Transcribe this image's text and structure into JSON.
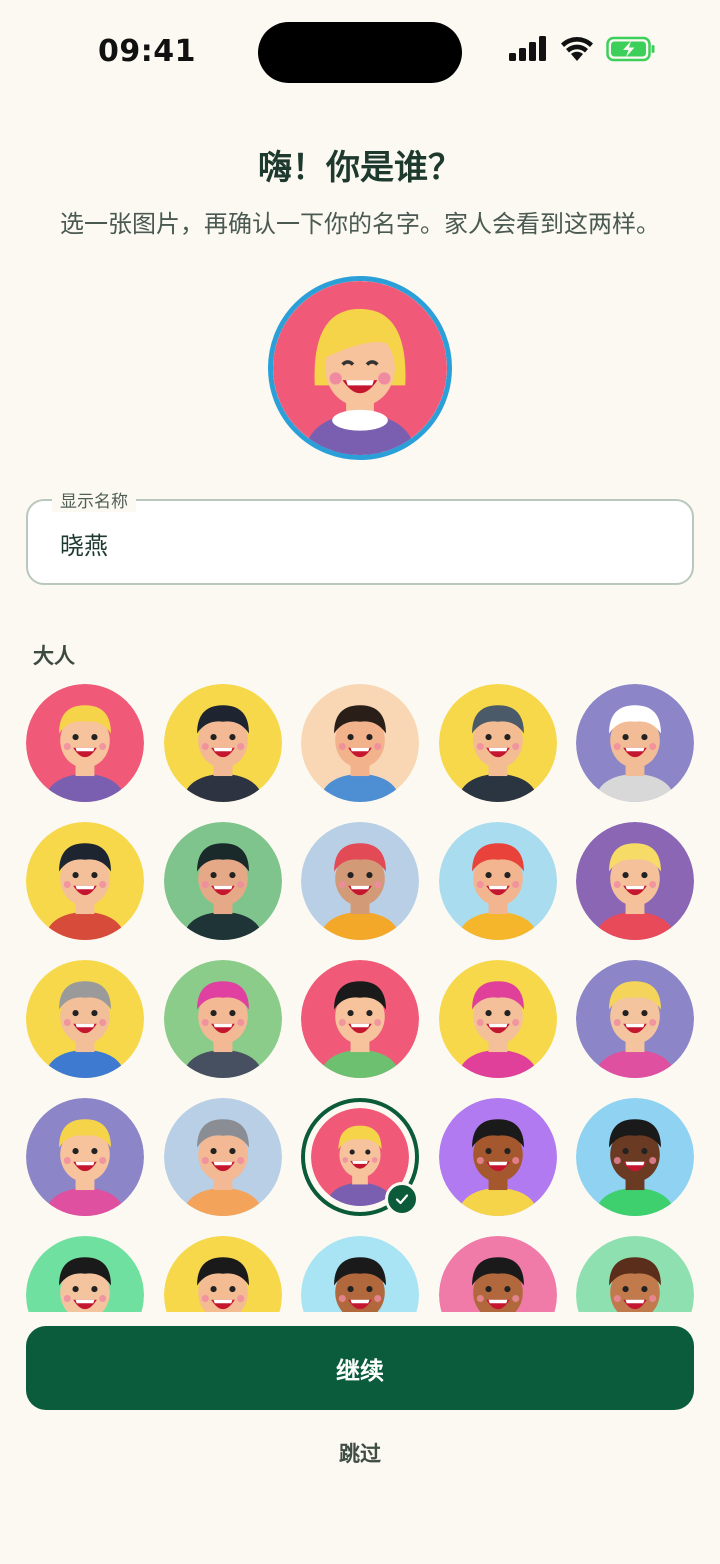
{
  "status_bar": {
    "time": "09:41"
  },
  "header": {
    "title": "嗨！你是谁？",
    "subtitle": "选一张图片，再确认一下你的名字。家人会看到这两样。"
  },
  "name_field": {
    "label": "显示名称",
    "value": "晓燕"
  },
  "section": {
    "label": "大人"
  },
  "avatars": [
    {
      "bg": "#f05a78",
      "skin": "#f6c39c",
      "hair": "#f6d44a",
      "shirt": "#7a5fb0"
    },
    {
      "bg": "#f6d84a",
      "skin": "#f2b994",
      "hair": "#1e2430",
      "shirt": "#2d3340"
    },
    {
      "bg": "#f9d7b4",
      "skin": "#f1b28c",
      "hair": "#2a1e18",
      "shirt": "#4e8fd4"
    },
    {
      "bg": "#f6d84a",
      "skin": "#f3bc93",
      "hair": "#4a5a68",
      "shirt": "#2b3542"
    },
    {
      "bg": "#8c86c8",
      "skin": "#f2bd96",
      "hair": "#ffffff",
      "shirt": "#d8d8d8"
    },
    {
      "bg": "#f6d84a",
      "skin": "#f4c09a",
      "hair": "#1c2530",
      "shirt": "#d64b3a"
    },
    {
      "bg": "#7fc48c",
      "skin": "#e6a987",
      "hair": "#1a2a2a",
      "shirt": "#1e3436"
    },
    {
      "bg": "#b9cfe6",
      "skin": "#d39a78",
      "hair": "#e24a55",
      "shirt": "#f4a82a"
    },
    {
      "bg": "#a9dcef",
      "skin": "#f2b58f",
      "hair": "#e8423a",
      "shirt": "#f6b62b"
    },
    {
      "bg": "#8a66b5",
      "skin": "#f5c19b",
      "hair": "#f6dc66",
      "shirt": "#e84a5a"
    },
    {
      "bg": "#f6d84a",
      "skin": "#f3bf98",
      "hair": "#9a9a9a",
      "shirt": "#3d7ad0"
    },
    {
      "bg": "#8ccc8a",
      "skin": "#f2b994",
      "hair": "#e040a0",
      "shirt": "#465060"
    },
    {
      "bg": "#f05a78",
      "skin": "#f6c39c",
      "hair": "#1a1a1a",
      "shirt": "#6cc070"
    },
    {
      "bg": "#f6d84a",
      "skin": "#f4c09a",
      "hair": "#e0409a",
      "shirt": "#e0409a"
    },
    {
      "bg": "#8c86c8",
      "skin": "#f4c49e",
      "hair": "#f4d45a",
      "shirt": "#e050a0"
    },
    {
      "bg": "#8c86c8",
      "skin": "#f6c39c",
      "hair": "#f6d44a",
      "shirt": "#e050a0"
    },
    {
      "bg": "#b9cfe6",
      "skin": "#f2b994",
      "hair": "#8a8e94",
      "shirt": "#f3a35a"
    },
    {
      "bg": "#f05a78",
      "skin": "#f6c39c",
      "hair": "#f6d44a",
      "shirt": "#7a5fb0"
    },
    {
      "bg": "#b27af0",
      "skin": "#a5582e",
      "hair": "#1a1a1a",
      "shirt": "#f6d44a"
    },
    {
      "bg": "#8fd2f2",
      "skin": "#6b3a22",
      "hair": "#1a1a1a",
      "shirt": "#3ecf6e"
    },
    {
      "bg": "#6fe0a0",
      "skin": "#f4c49e",
      "hair": "#1a1a1a",
      "shirt": "#f05a78"
    },
    {
      "bg": "#f6d84a",
      "skin": "#f3bc93",
      "hair": "#1a1a1a",
      "shirt": "#3d7ad0"
    },
    {
      "bg": "#a8e4f4",
      "skin": "#b0683c",
      "hair": "#1a1a1a",
      "shirt": "#e0409a"
    },
    {
      "bg": "#f07aa8",
      "skin": "#b0683c",
      "hair": "#1a1a1a",
      "shirt": "#3d7ad0"
    },
    {
      "bg": "#8fe0b0",
      "skin": "#c07a4c",
      "hair": "#5a2e1a",
      "shirt": "#f05a78"
    }
  ],
  "selected_index": 17,
  "actions": {
    "continue": "继续",
    "skip": "跳过"
  }
}
